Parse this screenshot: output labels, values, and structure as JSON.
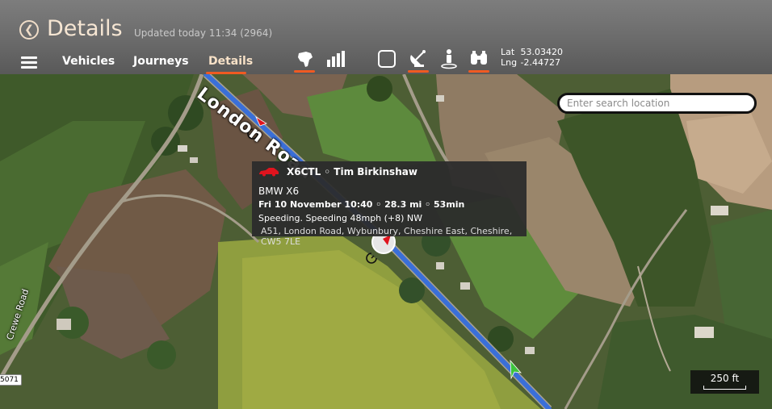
{
  "header": {
    "title": "Details",
    "updated": "Updated today 11:34 (2964)",
    "back_icon": "chevron-left-icon",
    "menu_icon": "hamburger-icon"
  },
  "nav": {
    "tabs": [
      {
        "label": "Vehicles",
        "active": false
      },
      {
        "label": "Journeys",
        "active": false
      },
      {
        "label": "Details",
        "active": true
      }
    ]
  },
  "toolbar": {
    "tools": [
      {
        "icon": "continent-map-icon",
        "active": true
      },
      {
        "icon": "bar-chart-icon",
        "active": false
      },
      {
        "icon": "square-select-icon",
        "active": false
      },
      {
        "icon": "satellite-dish-icon",
        "active": true
      },
      {
        "icon": "street-view-person-icon",
        "active": false
      },
      {
        "icon": "binoculars-icon",
        "active": true
      }
    ]
  },
  "coords": {
    "lat_label": "Lat",
    "lat": "53.03420",
    "lng_label": "Lng",
    "lng": "-2.44727"
  },
  "search": {
    "placeholder": "Enter search location"
  },
  "map": {
    "road_main": "London Road",
    "road_west": "Crewe Road",
    "road_shield": "5071",
    "scale": "250 ft"
  },
  "popup": {
    "vehicle": "X6CTL ◦ Tim Birkinshaw",
    "model": "BMW X6",
    "journey": "Fri 10 November 10:40 ◦ 28.3 mi ◦ 53min",
    "event": "Speeding. Speeding 48mph (+8) NW",
    "address": "A51, London Road, Wybunbury, Cheshire East, Cheshire, CW5 7LE"
  },
  "colors": {
    "accent": "#f05a22",
    "route": "#3a6fd8",
    "vehicle": "#e0141e",
    "start_marker": "#3cc43c"
  }
}
